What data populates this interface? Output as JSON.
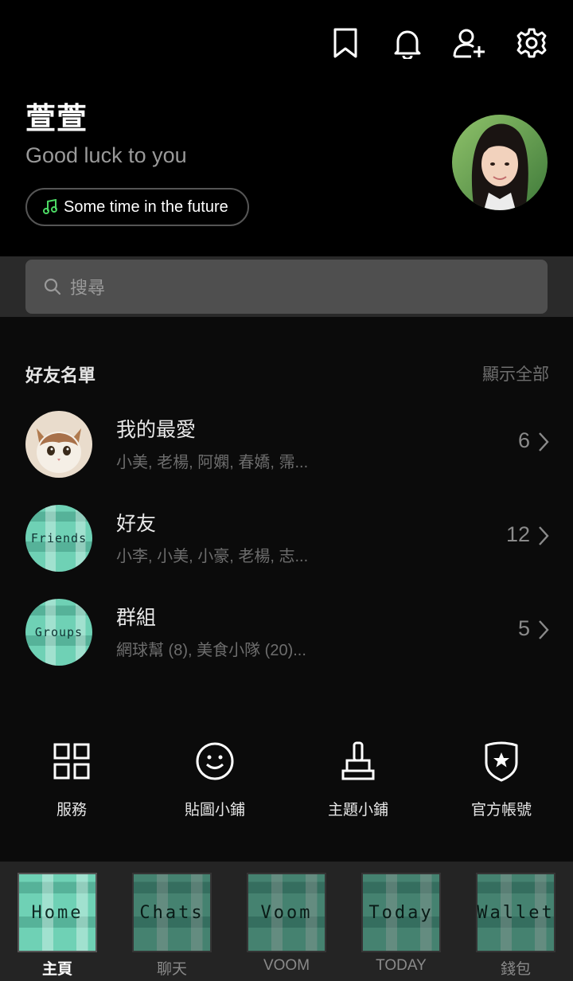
{
  "profile": {
    "name": "萱萱",
    "status_message": "Good luck to you",
    "music": "Some time in the future"
  },
  "header_icons": [
    "bookmark-icon",
    "bell-icon",
    "add-friend-icon",
    "settings-icon"
  ],
  "search": {
    "placeholder": "搜尋"
  },
  "friends_section": {
    "title": "好友名單",
    "show_all": "顯示全部",
    "rows": [
      {
        "title": "我的最愛",
        "subtitle": "小美, 老楊, 阿嫻, 春嬌, 霈...",
        "count": "6"
      },
      {
        "title": "好友",
        "subtitle": "小李, 小美, 小豪, 老楊, 志...",
        "count": "12",
        "badge": "Friends"
      },
      {
        "title": "群組",
        "subtitle": "網球幫 (8), 美食小隊 (20)...",
        "count": "5",
        "badge": "Groups"
      }
    ]
  },
  "services": [
    {
      "label": "服務",
      "icon": "grid-icon"
    },
    {
      "label": "貼圖小鋪",
      "icon": "smiley-icon"
    },
    {
      "label": "主題小鋪",
      "icon": "brush-icon"
    },
    {
      "label": "官方帳號",
      "icon": "shield-star-icon"
    }
  ],
  "tabs": [
    {
      "tile": "Home",
      "label": "主頁",
      "active": true
    },
    {
      "tile": "Chats",
      "label": "聊天"
    },
    {
      "tile": "Voom",
      "label": "VOOM"
    },
    {
      "tile": "Today",
      "label": "TODAY"
    },
    {
      "tile": "Wallet",
      "label": "錢包"
    }
  ],
  "colors": {
    "accent_plaid": "#6fd1b5",
    "music_note": "#4cd964"
  }
}
